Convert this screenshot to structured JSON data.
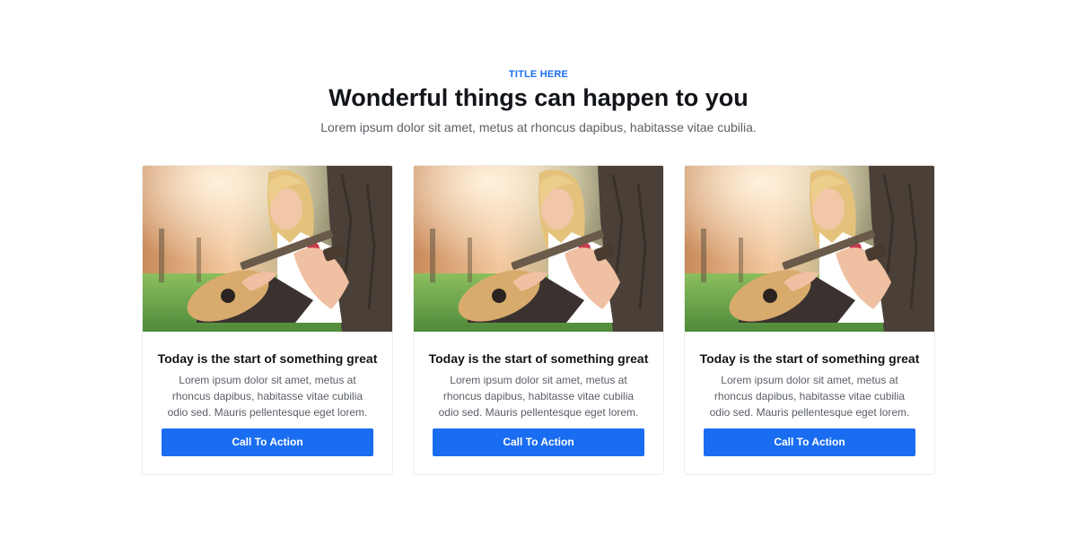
{
  "header": {
    "eyebrow": "TITLE HERE",
    "title": "Wonderful things can happen to you",
    "subtitle": "Lorem ipsum dolor sit amet, metus at rhoncus dapibus, habitasse vitae cubilia."
  },
  "cards": [
    {
      "title": "Today is the start of something great",
      "text": "Lorem ipsum dolor sit amet, metus at rhoncus dapibus, habitasse vitae cubilia odio sed. Mauris pellentesque eget lorem.",
      "cta_label": "Call To Action"
    },
    {
      "title": "Today is the start of something great",
      "text": "Lorem ipsum dolor sit amet, metus at rhoncus dapibus, habitasse vitae cubilia odio sed. Mauris pellentesque eget lorem.",
      "cta_label": "Call To Action"
    },
    {
      "title": "Today is the start of something great",
      "text": "Lorem ipsum dolor sit amet, metus at rhoncus dapibus, habitasse vitae cubilia odio sed. Mauris pellentesque eget lorem.",
      "cta_label": "Call To Action"
    }
  ],
  "colors": {
    "accent": "#1a6df0",
    "heading": "#111418",
    "body_text": "#5a5f66",
    "card_border": "#ececec"
  },
  "image": {
    "subject": "woman-playing-guitar-photo"
  }
}
